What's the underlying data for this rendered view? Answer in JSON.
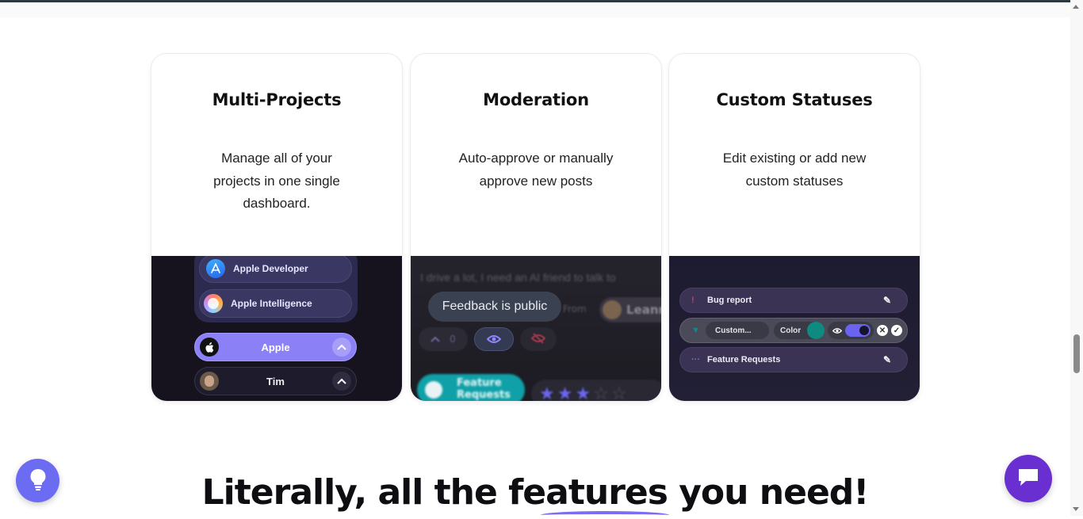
{
  "cards": [
    {
      "title": "Multi-Projects",
      "description": "Manage all of your projects in one single dashboard.",
      "preview": {
        "projects": [
          "Apple Developer",
          "Apple Intelligence"
        ],
        "selected_org": "Apple",
        "user": "Tim"
      }
    },
    {
      "title": "Moderation",
      "description": "Auto-approve or manually approve new posts",
      "preview": {
        "background_text": "I drive a lot, I need an AI friend to talk to",
        "tooltip": "Feedback is public",
        "from_label": "From",
        "author": "Leanne",
        "upvote_count": "0",
        "tag": "Feature Requests"
      }
    },
    {
      "title": "Custom Statuses",
      "description": "Edit existing or add new custom statuses",
      "preview": {
        "statuses": [
          "Bug report",
          "Feature Requests"
        ],
        "edit_name": "Custom...",
        "color_label": "Color"
      }
    }
  ],
  "bottom": {
    "heading": "Literally, all the features you need!"
  },
  "colors": {
    "accent": "#6c6cf2",
    "chat": "#6a2fd0",
    "selected": "#8b80f5",
    "teal": "#0fa0a8"
  }
}
